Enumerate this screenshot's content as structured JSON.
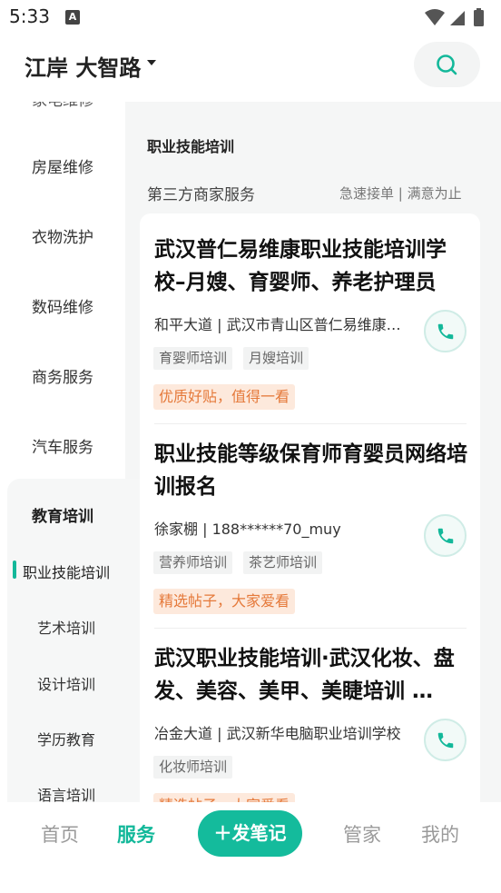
{
  "status_bar": {
    "time": "5:33",
    "notification_letter": "A"
  },
  "header": {
    "city": "江岸 大智路"
  },
  "sidebar": {
    "cut_item": "家电维修",
    "items": [
      "房屋维修",
      "衣物洗护",
      "数码维修",
      "商务服务",
      "汽车服务"
    ],
    "active_category": "教育培训",
    "sub_items": [
      "职业技能培训",
      "艺术培训",
      "设计培训",
      "学历教育",
      "语言培训"
    ]
  },
  "main": {
    "section_title": "职业技能培训",
    "provider_label": "第三方商家服务",
    "slogan": "急速接单 | 满意为止",
    "posts": [
      {
        "title": "武汉普仁易维康职业技能培训学校–月嫂、育婴师、养老护理员",
        "info": "和平大道 | 武汉市青山区普仁易维康职业技能培训学校",
        "tags": [
          "育婴师培训",
          "月嫂培训"
        ],
        "promo": "优质好贴，值得一看"
      },
      {
        "title": "职业技能等级保育师育婴员网络培训报名",
        "info": "徐家棚 | 188******70_muy",
        "tags": [
          "营养师培训",
          "茶艺师培训"
        ],
        "promo": "精选帖子，大家爱看"
      },
      {
        "title": "武汉职业技能培训·武汉化妆、盘发、美容、美甲、美睫培训 …",
        "info": "冶金大道 | 武汉新华电脑职业培训学校",
        "tags": [
          "化妆师培训"
        ],
        "promo": "精选帖子，大家爱看"
      }
    ]
  },
  "tabbar": {
    "home": "首页",
    "service": "服务",
    "post": "发笔记",
    "manage": "管家",
    "mine": "我的"
  },
  "colors": {
    "accent": "#13b89a",
    "promo_text": "#e5793a",
    "promo_bg": "#fde9dc"
  }
}
